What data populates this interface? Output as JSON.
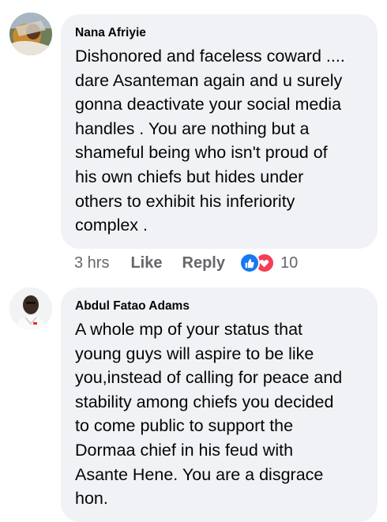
{
  "comments": [
    {
      "author": "Nana Afriyie",
      "text": "Dishonored and faceless coward ....\ndare Asanteman again and u surely\ngonna deactivate your social media\nhandles . You are nothing but a\nshameful being who isn't proud of\nhis own chiefs but hides under\nothers to exhibit his inferiority\ncomplex .",
      "time": "3 hrs",
      "like_label": "Like",
      "reply_label": "Reply",
      "reaction_count": "10",
      "reaction_icons": [
        "like-icon",
        "love-icon"
      ]
    },
    {
      "author": "Abdul Fatao Adams",
      "text": "A whole mp of your status that\nyoung guys will aspire to be like\nyou,instead of calling for peace and\nstability among chiefs you decided\nto come public to support the\nDormaa chief in his feud with\nAsante Hene. You are a disgrace\nhon."
    }
  ],
  "colors": {
    "bubble": "#f0f2f5",
    "meta_text": "#65676b",
    "like_blue": "#1877f2",
    "love_red": "#f33e58"
  }
}
